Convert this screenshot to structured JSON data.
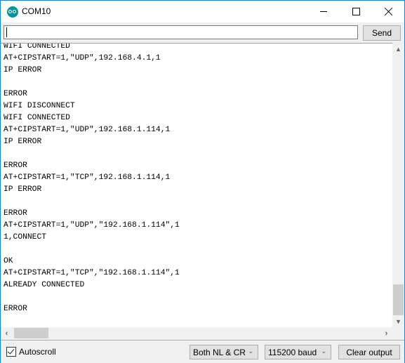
{
  "window": {
    "title": "COM10",
    "app_icon": "arduino-icon",
    "controls": [
      "minimize",
      "maximize",
      "close"
    ]
  },
  "input_row": {
    "input_value": "",
    "send_label": "Send"
  },
  "output": {
    "lines": [
      "WIFI CONNECTED",
      "AT+CIPSTART=1,\"UDP\",192.168.4.1,1",
      "IP ERROR",
      "",
      "ERROR",
      "WIFI DISCONNECT",
      "WIFI CONNECTED",
      "AT+CIPSTART=1,\"UDP\",192.168.1.114,1",
      "IP ERROR",
      "",
      "ERROR",
      "AT+CIPSTART=1,\"TCP\",192.168.1.114,1",
      "IP ERROR",
      "",
      "ERROR",
      "AT+CIPSTART=1,\"UDP\",\"192.168.1.114\",1",
      "1,CONNECT",
      "",
      "OK",
      "AT+CIPSTART=1,\"TCP\",\"192.168.1.114\",1",
      "ALREADY CONNECTED",
      "",
      "ERROR"
    ]
  },
  "scrollbars": {
    "vertical_position": 0.95,
    "horizontal_position": 0.0
  },
  "bottom_bar": {
    "autoscroll_label": "Autoscroll",
    "autoscroll_checked": true,
    "line_ending_selected": "Both NL & CR",
    "baud_selected": "115200 baud",
    "clear_label": "Clear output"
  }
}
